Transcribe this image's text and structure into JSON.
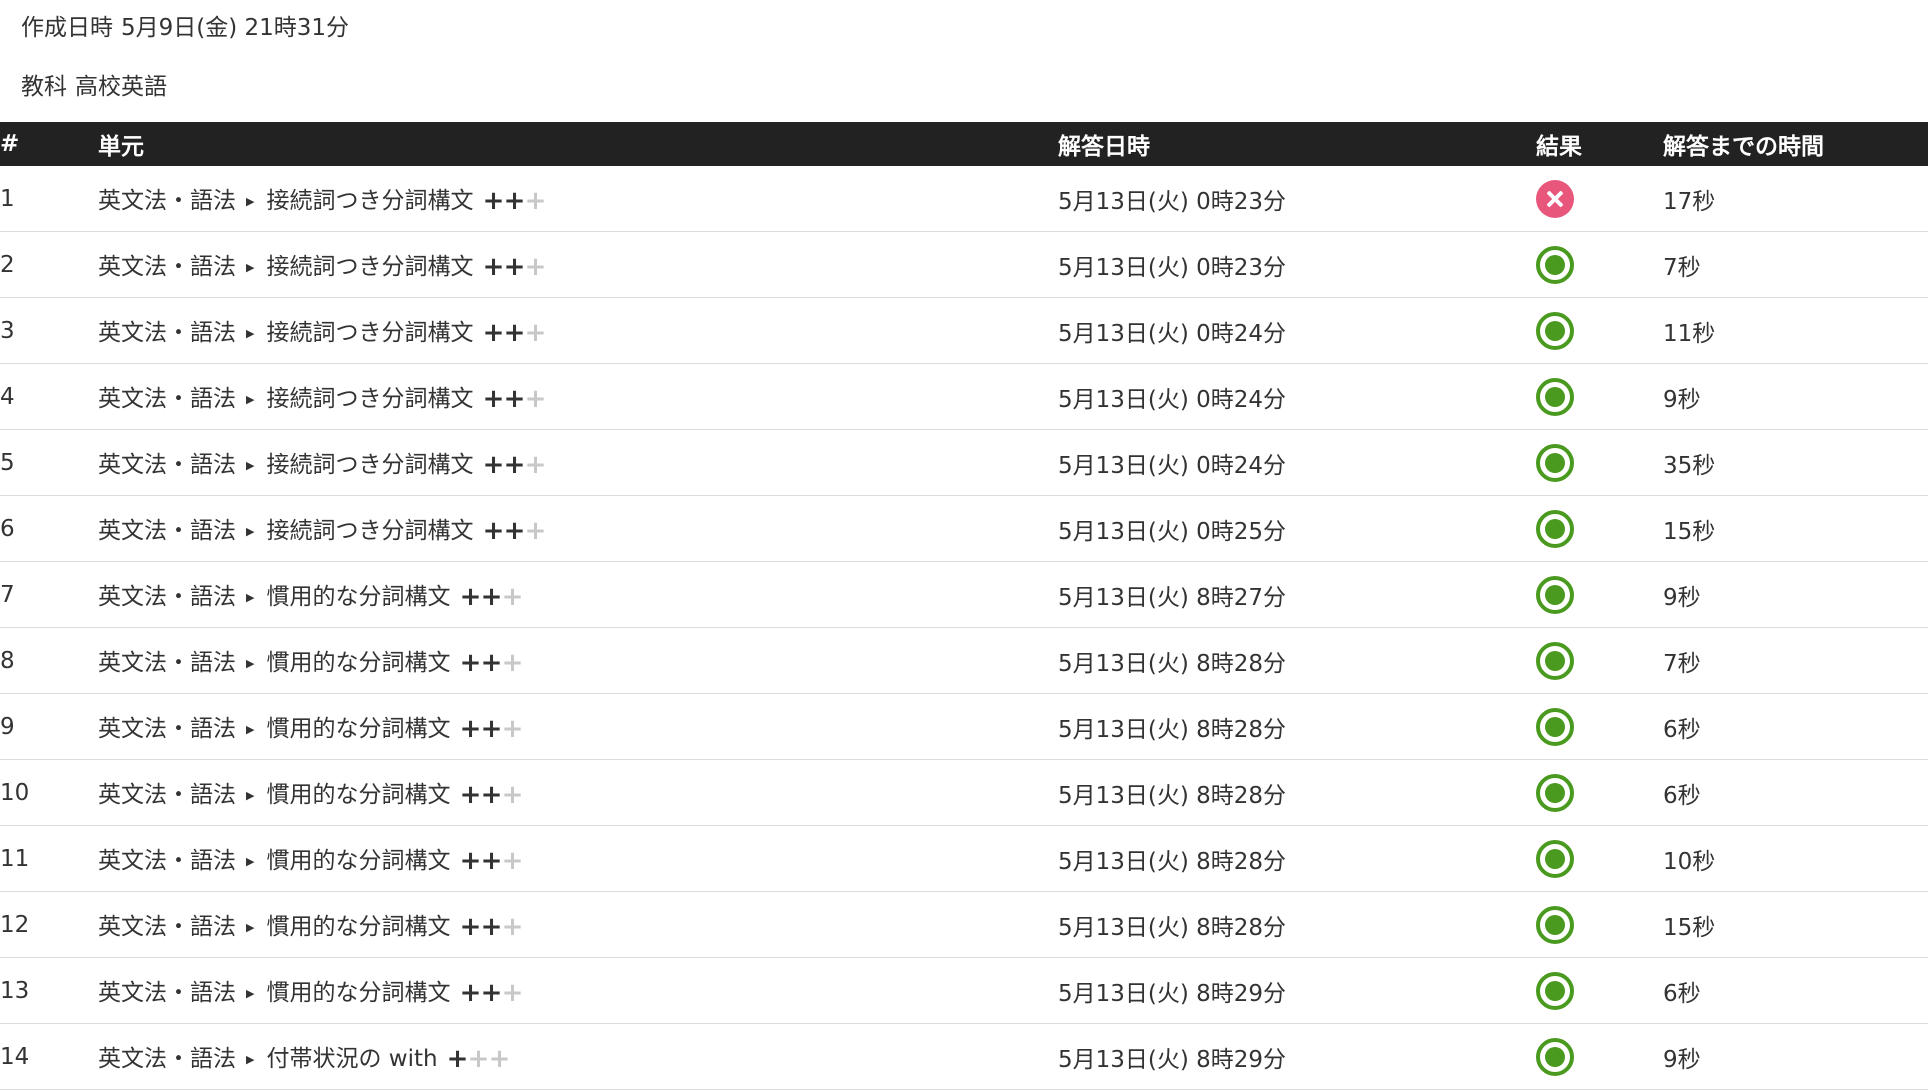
{
  "meta": {
    "created_label": "作成日時",
    "created_value": "5月9日(金) 21時31分",
    "subject_label": "教科",
    "subject_value": "高校英語"
  },
  "table": {
    "headers": {
      "num": "#",
      "unit": "単元",
      "date": "解答日時",
      "result": "結果",
      "time": "解答までの時間"
    },
    "rows": [
      {
        "num": "1",
        "category": "英文法・語法",
        "unit": "接続詞つき分詞構文",
        "level": 2,
        "date": "5月13日(火) 0時23分",
        "result": "incorrect",
        "time": "17秒"
      },
      {
        "num": "2",
        "category": "英文法・語法",
        "unit": "接続詞つき分詞構文",
        "level": 2,
        "date": "5月13日(火) 0時23分",
        "result": "correct",
        "time": "7秒"
      },
      {
        "num": "3",
        "category": "英文法・語法",
        "unit": "接続詞つき分詞構文",
        "level": 2,
        "date": "5月13日(火) 0時24分",
        "result": "correct",
        "time": "11秒"
      },
      {
        "num": "4",
        "category": "英文法・語法",
        "unit": "接続詞つき分詞構文",
        "level": 2,
        "date": "5月13日(火) 0時24分",
        "result": "correct",
        "time": "9秒"
      },
      {
        "num": "5",
        "category": "英文法・語法",
        "unit": "接続詞つき分詞構文",
        "level": 2,
        "date": "5月13日(火) 0時24分",
        "result": "correct",
        "time": "35秒"
      },
      {
        "num": "6",
        "category": "英文法・語法",
        "unit": "接続詞つき分詞構文",
        "level": 2,
        "date": "5月13日(火) 0時25分",
        "result": "correct",
        "time": "15秒"
      },
      {
        "num": "7",
        "category": "英文法・語法",
        "unit": "慣用的な分詞構文",
        "level": 2,
        "date": "5月13日(火) 8時27分",
        "result": "correct",
        "time": "9秒"
      },
      {
        "num": "8",
        "category": "英文法・語法",
        "unit": "慣用的な分詞構文",
        "level": 2,
        "date": "5月13日(火) 8時28分",
        "result": "correct",
        "time": "7秒"
      },
      {
        "num": "9",
        "category": "英文法・語法",
        "unit": "慣用的な分詞構文",
        "level": 2,
        "date": "5月13日(火) 8時28分",
        "result": "correct",
        "time": "6秒"
      },
      {
        "num": "10",
        "category": "英文法・語法",
        "unit": "慣用的な分詞構文",
        "level": 2,
        "date": "5月13日(火) 8時28分",
        "result": "correct",
        "time": "6秒"
      },
      {
        "num": "11",
        "category": "英文法・語法",
        "unit": "慣用的な分詞構文",
        "level": 2,
        "date": "5月13日(火) 8時28分",
        "result": "correct",
        "time": "10秒"
      },
      {
        "num": "12",
        "category": "英文法・語法",
        "unit": "慣用的な分詞構文",
        "level": 2,
        "date": "5月13日(火) 8時28分",
        "result": "correct",
        "time": "15秒"
      },
      {
        "num": "13",
        "category": "英文法・語法",
        "unit": "慣用的な分詞構文",
        "level": 2,
        "date": "5月13日(火) 8時29分",
        "result": "correct",
        "time": "6秒"
      },
      {
        "num": "14",
        "category": "英文法・語法",
        "unit": "付帯状況の with",
        "level": 1,
        "date": "5月13日(火) 8時29分",
        "result": "correct",
        "time": "9秒"
      }
    ]
  },
  "icons": {
    "correct": "correct-circle-icon",
    "incorrect": "incorrect-x-icon",
    "separator": "triangle-right-icon",
    "level": "plus-icon"
  },
  "colors": {
    "header_bg": "#222222",
    "correct": "#4a9a1f",
    "incorrect": "#e8567c",
    "level_on": "#333333",
    "level_off": "#c8c8c8"
  },
  "level_max": 3
}
